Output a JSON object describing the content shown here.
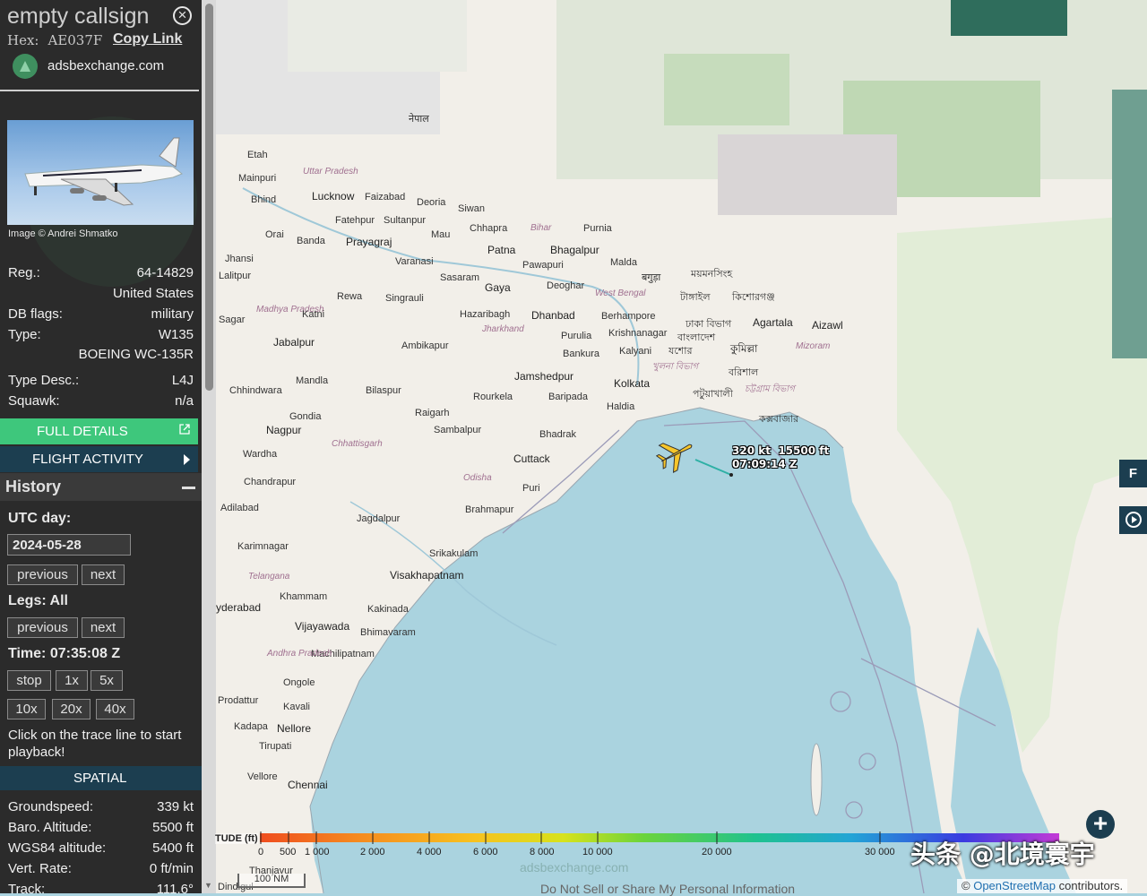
{
  "header": {
    "callsign": "empty callsign",
    "hex_label": "Hex:",
    "hex_value": "AE037F",
    "copy_link": "Copy Link",
    "site": "adsbexchange.com"
  },
  "photo": {
    "credit": "Image © Andrei Shmatko"
  },
  "details": {
    "reg_label": "Reg.:",
    "reg_value": "64-14829",
    "country": "United States",
    "dbflags_label": "DB flags:",
    "dbflags_value": "military",
    "type_label": "Type:",
    "type_value": "W135",
    "type_name": "BOEING WC-135R",
    "typedesc_label": "Type Desc.:",
    "typedesc_value": "L4J",
    "squawk_label": "Squawk:",
    "squawk_value": "n/a"
  },
  "buttons": {
    "full_details": "FULL DETAILS",
    "flight_activity": "FLIGHT ACTIVITY"
  },
  "history": {
    "title": "History",
    "utc_day_label": "UTC day:",
    "utc_day_value": "2024-05-28",
    "previous": "previous",
    "next": "next",
    "legs_label": "Legs: All",
    "time_label": "Time: 07:35:08 Z",
    "speed_buttons": [
      "stop",
      "1x",
      "5x",
      "10x",
      "20x",
      "40x"
    ],
    "click_note": "Click on the trace line to start playback!"
  },
  "spatial": {
    "title": "SPATIAL",
    "groundspeed_label": "Groundspeed:",
    "groundspeed_value": "339 kt",
    "baro_label": "Baro. Altitude:",
    "baro_value": "5500 ft",
    "wgs_label": "WGS84 altitude:",
    "wgs_value": "5400 ft",
    "vert_label": "Vert. Rate:",
    "vert_value": "0 ft/min",
    "track_label": "Track:",
    "track_value": "111.6°"
  },
  "map": {
    "plane_speed": "320 kt",
    "plane_alt": "15500 ft",
    "plane_time": "07:09:14 Z",
    "legend_title": "TUDE (ft)",
    "legend_ticks": [
      "0",
      "500",
      "1 000",
      "2 000",
      "4 000",
      "6 000",
      "8 000",
      "10 000",
      "20 000",
      "30 000"
    ],
    "right_button_f": "F",
    "scale": "100 NM",
    "watermark": "adsbexchange.com",
    "do_not_sell": "Do Not Sell or Share My Personal Information",
    "attribution_prefix": "©",
    "attribution_link": "OpenStreetMap",
    "attribution_suffix": "contributors.",
    "cn_watermark": "头条 @北境寰宇",
    "places": [
      "नेपाल",
      "Etah",
      "Uttar Pradesh",
      "Mainpuri",
      "Lucknow",
      "Faizabad",
      "Bhind",
      "Deoria",
      "Siwan",
      "Fatehpur",
      "Sultanpur",
      "Chhapra",
      "Bihar",
      "Purnia",
      "Orai",
      "Mau",
      "Banda",
      "Prayagraj",
      "Patna",
      "Bhagalpur",
      "Jhansi",
      "Varanasi",
      "Malda",
      "Lalitpur",
      "Sasaram",
      "Gaya",
      "Pawapuri",
      "Deoghar",
      "बगुड़ा",
      "ময়মনসিংহ",
      "West Bengal",
      "Rewa",
      "Singrauli",
      "Madhya Pradesh",
      "Katni",
      "Hazaribagh",
      "Dhanbad",
      "Berhampore",
      "টাঙ্গাইল",
      "কিশোরগঞ্জ",
      "Sagar",
      "Jharkhand",
      "Purulia",
      "Krishnanagar",
      "ঢাকা বিভাগ",
      "বাংলাদেশ",
      "Agartala",
      "Aizawl",
      "Jabalpur",
      "Ambikapur",
      "Bankura",
      "যশোর",
      "কুমিল্লা",
      "Mizoram",
      "Kalyani",
      "খুলনা বিভাগ",
      "বরিশাল",
      "Mandla",
      "Jamshedpur",
      "Kolkata",
      "পটুয়াখালী",
      "চট্টগ্রাম বিভাগ",
      "Chhindwara",
      "Bilaspur",
      "Rourkela",
      "Baripada",
      "Haldia",
      "Gondia",
      "Raigarh",
      "কক্সবাজার",
      "Sambalpur",
      "Nagpur",
      "Bhadrak",
      "Chhattisgarh",
      "Wardha",
      "Cuttack",
      "Odisha",
      "Puri",
      "Chandrapur",
      "Brahmapur",
      "Adilabad",
      "Jagdalpur",
      "Karimnagar",
      "Srikakulam",
      "Telangana",
      "Visakhapatnam",
      "Khammam",
      "Kakinada",
      "yderabad",
      "Vijayawada",
      "Bhimavaram",
      "Machilipatnam",
      "Andhra Pradesh",
      "Ongole",
      "Prodattur",
      "Kavali",
      "Nellore",
      "Tirupati",
      "Vellore",
      "Chennai",
      "Kadapa",
      "Thanjavur",
      "Dindigul"
    ]
  }
}
